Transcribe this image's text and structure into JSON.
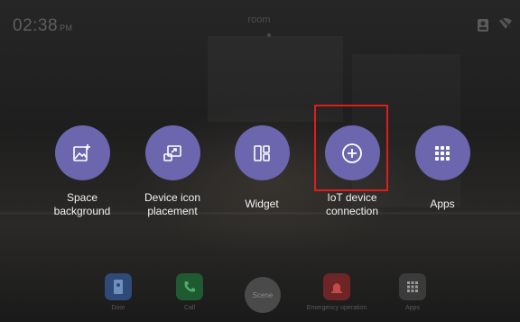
{
  "status_bar": {
    "time": "02:38",
    "ampm": "PM",
    "room_name": "room"
  },
  "menu": {
    "items": [
      {
        "id": "space-background",
        "label": "Space\nbackground",
        "icon": "image-plus-icon"
      },
      {
        "id": "device-icon-placement",
        "label": "Device icon\nplacement",
        "icon": "screen-share-icon"
      },
      {
        "id": "widget",
        "label": "Widget",
        "icon": "widget-layout-icon"
      },
      {
        "id": "iot-device-connection",
        "label": "IoT device\nconnection",
        "icon": "add-circle-icon"
      },
      {
        "id": "apps",
        "label": "Apps",
        "icon": "grid-icon"
      }
    ],
    "accent_color": "#6b66ad",
    "highlight_color": "#e21b1b"
  },
  "dock": {
    "items": [
      {
        "label": "Door",
        "icon": "door-icon",
        "color": "#2f4a78"
      },
      {
        "label": "Call",
        "icon": "phone-icon",
        "color": "#1f5a33"
      },
      {
        "label": "Emergency operation",
        "icon": "emergency-icon",
        "color": "#6e2525"
      },
      {
        "label": "Apps",
        "icon": "grid-icon",
        "color": "#3b3b3b"
      }
    ],
    "scene_label": "Scene"
  }
}
